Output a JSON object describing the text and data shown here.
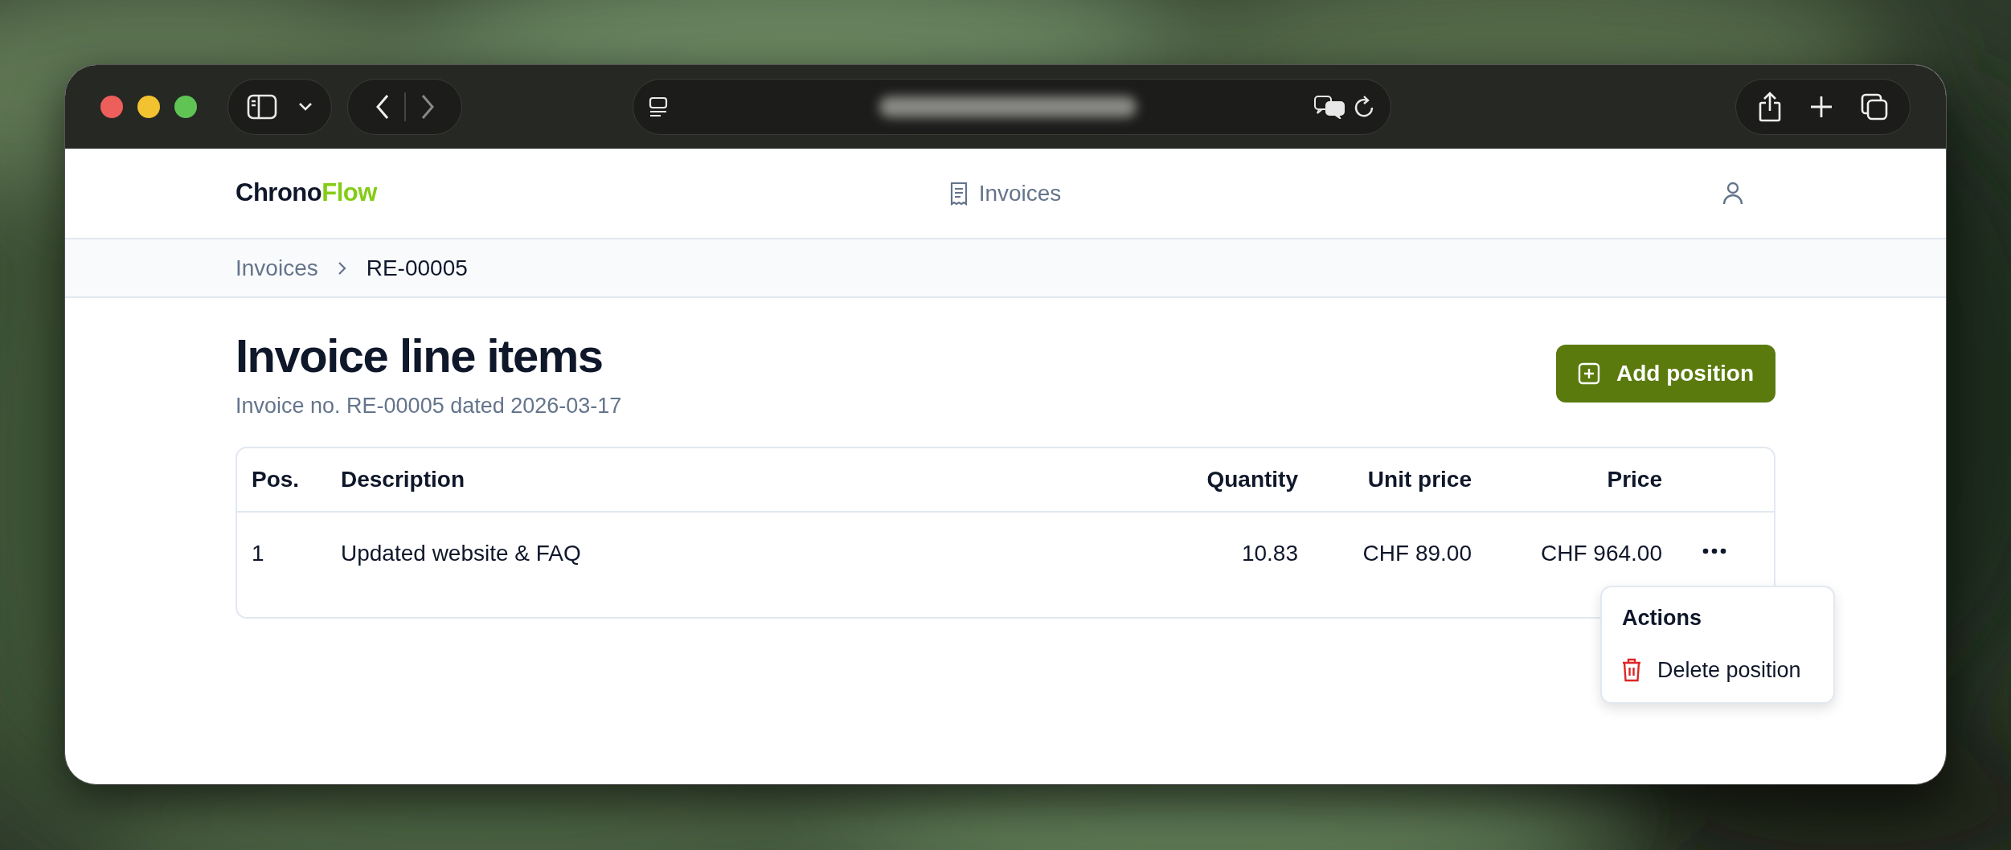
{
  "header": {
    "logo": {
      "primary": "Chrono",
      "accent": "Flow"
    },
    "nav": [
      {
        "label": "Invoices"
      }
    ]
  },
  "breadcrumb": [
    {
      "label": "Invoices",
      "kind": "link"
    },
    {
      "label": "RE-00005",
      "kind": "current"
    }
  ],
  "page": {
    "title": "Invoice line items",
    "subtitle": "Invoice no. RE-00005 dated 2026-03-17",
    "action": "Add position"
  },
  "table": {
    "columns": [
      {
        "label": "Pos."
      },
      {
        "label": "Description"
      },
      {
        "label": "Quantity"
      },
      {
        "label": "Unit price"
      },
      {
        "label": "Price"
      }
    ],
    "rows": [
      {
        "cells": [
          "1",
          "Updated website & FAQ",
          "10.83",
          "CHF 89.00",
          "CHF 964.00"
        ]
      }
    ]
  },
  "menu": {
    "title": "Actions",
    "items": [
      {
        "label": "Delete position",
        "kind": "danger"
      }
    ]
  }
}
